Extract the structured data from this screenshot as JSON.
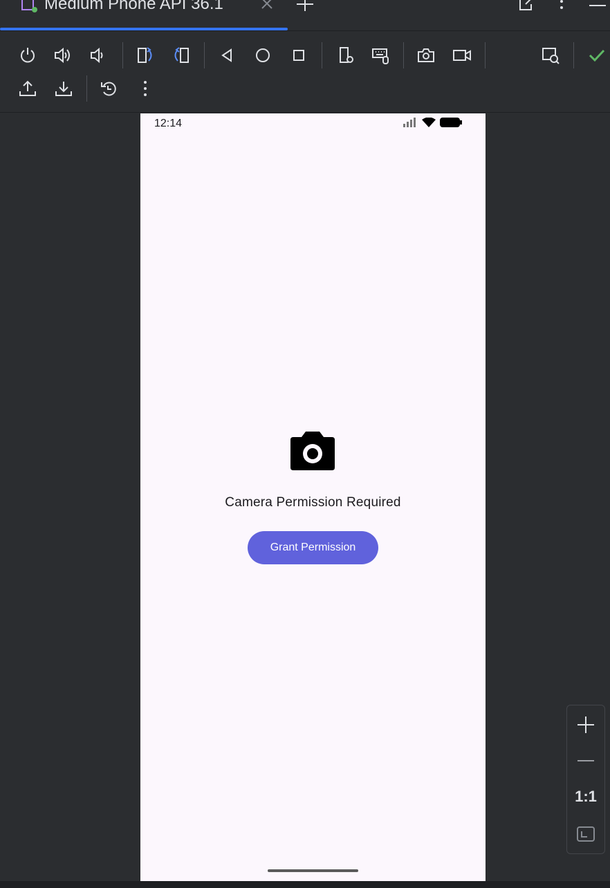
{
  "window": {
    "tab_title": "Medium Phone API 36.1",
    "tab_close_icon": "close-icon",
    "add_tab_icon": "plus-icon"
  },
  "toolbar": {
    "row1": [
      "power-icon",
      "volume-up-icon",
      "volume-down-icon",
      "rotate-left-icon",
      "rotate-right-icon",
      "back-icon",
      "home-icon",
      "overview-icon",
      "device-settings-icon",
      "keyboard-mouse-icon",
      "screenshot-icon",
      "screen-record-icon",
      "inspect-icon",
      "check-icon"
    ],
    "row2": [
      "upload-icon",
      "download-icon",
      "snapshot-icon",
      "more-icon"
    ]
  },
  "device": {
    "status_time": "12:14",
    "status_icons": [
      "signal-icon",
      "wifi-icon",
      "battery-icon"
    ],
    "permission_title": "Camera Permission Required",
    "grant_button_label": "Grant Permission"
  },
  "zoom": {
    "zoom_in_icon": "plus-icon",
    "zoom_out_icon": "minus-icon",
    "actual_size_label": "1:1",
    "fit_icon": "fit-screen-icon"
  },
  "colors": {
    "accent": "#3574f0",
    "button": "#6062dc",
    "screen_bg": "#fcf7fd",
    "check": "#5fb865"
  }
}
